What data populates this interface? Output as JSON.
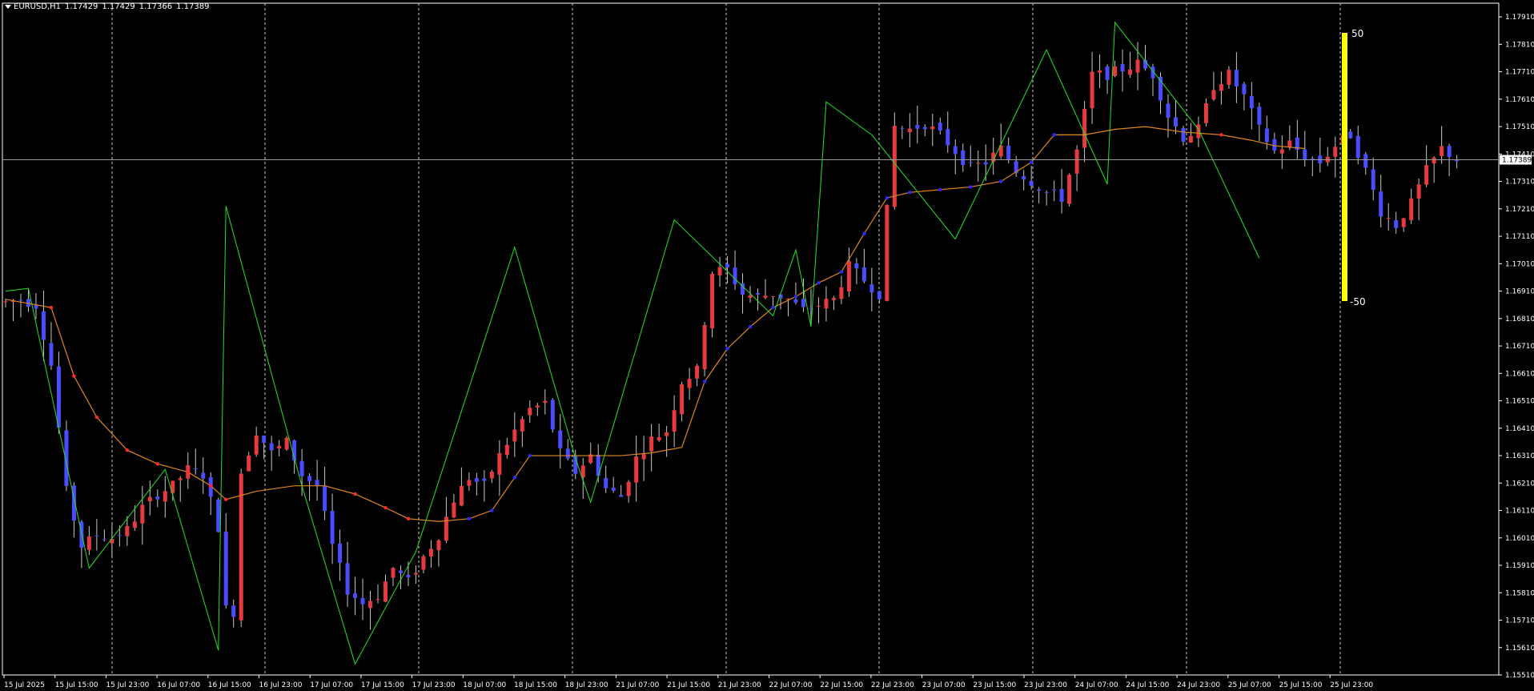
{
  "header": {
    "symbol": "EURUSD,H1",
    "open": "1.17429",
    "high": "1.17429",
    "low": "1.17366",
    "close": "1.17389"
  },
  "chart_data": {
    "type": "candlestick",
    "symbol": "EURUSD",
    "timeframe": "H1",
    "grid": "vertical dashed separators",
    "colors": {
      "background": "#000000",
      "bull_candle": "#e8393f",
      "bear_candle": "#4b4bff",
      "wick": "#c8c8c8",
      "ma_line": "#e0861a",
      "trail_down": "#ff2a2a",
      "trail_up": "#2a2aff",
      "zigzag": "#1fe61f",
      "oscillator_bar": "#ffff00",
      "axis": "#ffffff"
    },
    "ylim": [
      1.1551,
      1.1796
    ],
    "yticks": [
      "1.17910",
      "1.17810",
      "1.17710",
      "1.17610",
      "1.17510",
      "1.17410",
      "1.17310",
      "1.17210",
      "1.17110",
      "1.17010",
      "1.16910",
      "1.16810",
      "1.16710",
      "1.16610",
      "1.16510",
      "1.16410",
      "1.16310",
      "1.16210",
      "1.16110",
      "1.16010",
      "1.15910",
      "1.15810",
      "1.15710",
      "1.15610",
      "1.15510"
    ],
    "xticks": [
      "15 Jul 2025",
      "15 Jul 15:00",
      "15 Jul 23:00",
      "16 Jul 07:00",
      "16 Jul 15:00",
      "16 Jul 23:00",
      "17 Jul 07:00",
      "17 Jul 15:00",
      "17 Jul 23:00",
      "18 Jul 07:00",
      "18 Jul 15:00",
      "18 Jul 23:00",
      "21 Jul 07:00",
      "21 Jul 15:00",
      "21 Jul 23:00",
      "22 Jul 07:00",
      "22 Jul 15:00",
      "22 Jul 23:00",
      "23 Jul 07:00",
      "23 Jul 15:00",
      "23 Jul 23:00",
      "24 Jul 07:00",
      "24 Jul 15:00",
      "24 Jul 23:00",
      "25 Jul 07:00",
      "25 Jul 15:00",
      "25 Jul 23:00"
    ],
    "current_price": "1.17389",
    "oscillator": {
      "max_label": "50",
      "min_label": "-50"
    },
    "close_path": [
      [
        0,
        1.1687
      ],
      [
        2,
        1.1688
      ],
      [
        4,
        1.1686
      ],
      [
        6,
        1.1664
      ],
      [
        8,
        1.1618
      ],
      [
        10,
        1.1598
      ],
      [
        12,
        1.1602
      ],
      [
        14,
        1.1601
      ],
      [
        16,
        1.1604
      ],
      [
        18,
        1.1612
      ],
      [
        20,
        1.1617
      ],
      [
        22,
        1.162
      ],
      [
        24,
        1.1626
      ],
      [
        26,
        1.1624
      ],
      [
        28,
        1.1605
      ],
      [
        29,
        1.1575
      ],
      [
        30,
        1.1574
      ],
      [
        31,
        1.1625
      ],
      [
        33,
        1.164
      ],
      [
        35,
        1.1632
      ],
      [
        37,
        1.1636
      ],
      [
        39,
        1.1624
      ],
      [
        41,
        1.162
      ],
      [
        43,
        1.1598
      ],
      [
        45,
        1.1582
      ],
      [
        47,
        1.1577
      ],
      [
        49,
        1.158
      ],
      [
        51,
        1.159
      ],
      [
        53,
        1.1585
      ],
      [
        55,
        1.1594
      ],
      [
        57,
        1.1602
      ],
      [
        59,
        1.1615
      ],
      [
        61,
        1.1623
      ],
      [
        63,
        1.162
      ],
      [
        65,
        1.1631
      ],
      [
        67,
        1.164
      ],
      [
        69,
        1.1648
      ],
      [
        71,
        1.165
      ],
      [
        73,
        1.1632
      ],
      [
        75,
        1.1625
      ],
      [
        77,
        1.1631
      ],
      [
        79,
        1.1619
      ],
      [
        81,
        1.1616
      ],
      [
        83,
        1.163
      ],
      [
        85,
        1.1637
      ],
      [
        87,
        1.164
      ],
      [
        89,
        1.1658
      ],
      [
        91,
        1.1662
      ],
      [
        93,
        1.1698
      ],
      [
        95,
        1.1699
      ],
      [
        97,
        1.169
      ],
      [
        99,
        1.1689
      ],
      [
        101,
        1.169
      ],
      [
        103,
        1.1688
      ],
      [
        105,
        1.1684
      ],
      [
        107,
        1.1686
      ],
      [
        109,
        1.1688
      ],
      [
        111,
        1.17
      ],
      [
        113,
        1.1695
      ],
      [
        115,
        1.169
      ],
      [
        117,
        1.1751
      ],
      [
        119,
        1.175
      ],
      [
        121,
        1.1752
      ],
      [
        123,
        1.1748
      ],
      [
        125,
        1.1742
      ],
      [
        127,
        1.1736
      ],
      [
        129,
        1.1738
      ],
      [
        131,
        1.1743
      ],
      [
        133,
        1.1735
      ],
      [
        135,
        1.1731
      ],
      [
        137,
        1.1727
      ],
      [
        139,
        1.1725
      ],
      [
        141,
        1.1742
      ],
      [
        143,
        1.177
      ],
      [
        145,
        1.177
      ],
      [
        147,
        1.1772
      ],
      [
        149,
        1.1774
      ],
      [
        151,
        1.177
      ],
      [
        153,
        1.1755
      ],
      [
        155,
        1.1747
      ],
      [
        157,
        1.175
      ],
      [
        159,
        1.1766
      ],
      [
        161,
        1.177
      ],
      [
        163,
        1.1762
      ],
      [
        165,
        1.175
      ],
      [
        167,
        1.1742
      ],
      [
        169,
        1.1745
      ],
      [
        171,
        1.174
      ],
      [
        173,
        1.1738
      ],
      [
        175,
        1.1744
      ],
      [
        177,
        1.1748
      ],
      [
        179,
        1.1735
      ],
      [
        181,
        1.172
      ],
      [
        183,
        1.1715
      ],
      [
        185,
        1.1723
      ],
      [
        187,
        1.1735
      ],
      [
        189,
        1.1743
      ],
      [
        191,
        1.1739
      ]
    ],
    "ma_path": [
      [
        0,
        1.1688
      ],
      [
        6,
        1.1685
      ],
      [
        9,
        1.166
      ],
      [
        12,
        1.1645
      ],
      [
        16,
        1.1633
      ],
      [
        20,
        1.1628
      ],
      [
        24,
        1.1625
      ],
      [
        27,
        1.162
      ],
      [
        29,
        1.1615
      ],
      [
        33,
        1.1618
      ],
      [
        38,
        1.162
      ],
      [
        42,
        1.162
      ],
      [
        46,
        1.1617
      ],
      [
        50,
        1.1612
      ],
      [
        53,
        1.1608
      ],
      [
        57,
        1.1607
      ],
      [
        61,
        1.1608
      ],
      [
        64,
        1.1611
      ],
      [
        67,
        1.1623
      ],
      [
        69,
        1.1631
      ],
      [
        73,
        1.1631
      ],
      [
        77,
        1.1631
      ],
      [
        81,
        1.1631
      ],
      [
        85,
        1.1632
      ],
      [
        89,
        1.1634
      ],
      [
        92,
        1.1658
      ],
      [
        95,
        1.167
      ],
      [
        98,
        1.1678
      ],
      [
        101,
        1.1685
      ],
      [
        104,
        1.1689
      ],
      [
        107,
        1.1694
      ],
      [
        110,
        1.1698
      ],
      [
        113,
        1.1712
      ],
      [
        116,
        1.1725
      ],
      [
        119,
        1.1727
      ],
      [
        123,
        1.1728
      ],
      [
        127,
        1.1729
      ],
      [
        131,
        1.1731
      ],
      [
        135,
        1.1738
      ],
      [
        138,
        1.1748
      ],
      [
        142,
        1.1748
      ],
      [
        146,
        1.175
      ],
      [
        150,
        1.1751
      ],
      [
        155,
        1.1749
      ],
      [
        160,
        1.1748
      ],
      [
        164,
        1.1746
      ],
      [
        167,
        1.1744
      ],
      [
        171,
        1.1743
      ]
    ],
    "zigzag_path": [
      [
        0,
        1.1691
      ],
      [
        3,
        1.1692
      ],
      [
        11,
        1.159
      ],
      [
        21,
        1.1626
      ],
      [
        28,
        1.156
      ],
      [
        29,
        1.1722
      ],
      [
        39,
        1.162
      ],
      [
        46,
        1.1555
      ],
      [
        54,
        1.1596
      ],
      [
        67,
        1.1707
      ],
      [
        75,
        1.163
      ],
      [
        77,
        1.1614
      ],
      [
        88,
        1.1717
      ],
      [
        101,
        1.1682
      ],
      [
        104,
        1.1706
      ],
      [
        106,
        1.1678
      ],
      [
        108,
        1.176
      ],
      [
        114,
        1.1748
      ],
      [
        125,
        1.171
      ],
      [
        137,
        1.1779
      ],
      [
        145,
        1.173
      ],
      [
        146,
        1.1789
      ],
      [
        157,
        1.175
      ],
      [
        165,
        1.1703
      ]
    ],
    "oscillator_value": 50
  }
}
